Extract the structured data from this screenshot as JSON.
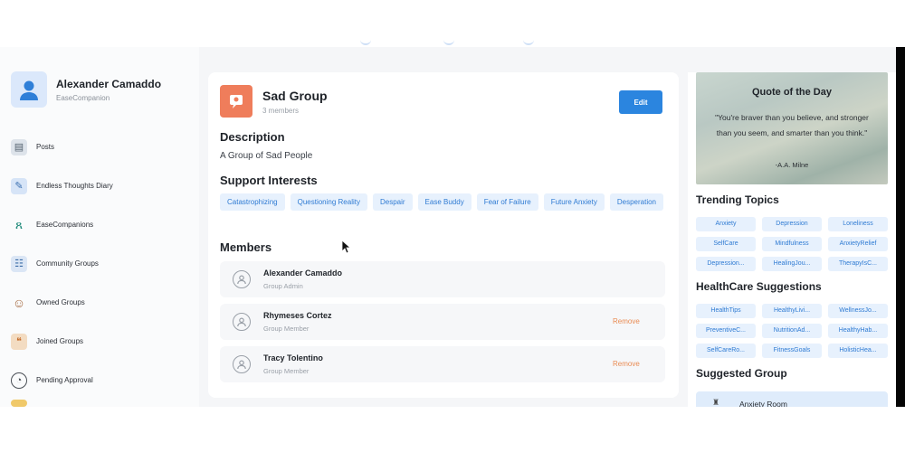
{
  "profile": {
    "name": "Alexander Camaddo",
    "subtitle": "EaseCompanion"
  },
  "sidebar": {
    "items": [
      {
        "label": "Posts",
        "icon": "posts-icon"
      },
      {
        "label": "Endless Thoughts Diary",
        "icon": "diary-icon"
      },
      {
        "label": "EaseCompanions",
        "icon": "ribbon-icon"
      },
      {
        "label": "Community Groups",
        "icon": "community-icon"
      },
      {
        "label": "Owned Groups",
        "icon": "owner-icon"
      },
      {
        "label": "Joined Groups",
        "icon": "chat-bubbles-icon"
      },
      {
        "label": "Pending Approval",
        "icon": "pending-icon"
      }
    ]
  },
  "group": {
    "title": "Sad Group",
    "members_count": "3 members",
    "edit_label": "Edit",
    "description_heading": "Description",
    "description": "A Group of Sad People",
    "interests_heading": "Support Interests",
    "interests": [
      "Catastrophizing",
      "Questioning Reality",
      "Despair",
      "Ease Buddy",
      "Fear of Failure",
      "Future Anxiety",
      "Desperation"
    ],
    "members_heading": "Members",
    "members": [
      {
        "name": "Alexander Camaddo",
        "role": "Group Admin",
        "action": ""
      },
      {
        "name": "Rhymeses Cortez",
        "role": "Group Member",
        "action": "Remove"
      },
      {
        "name": "Tracy Tolentino",
        "role": "Group Member",
        "action": "Remove"
      }
    ]
  },
  "quote": {
    "title": "Quote of the Day",
    "text": "\"You're braver than you believe, and stronger than you seem, and smarter than you think.\"",
    "author": "-A.A. Milne"
  },
  "trending": {
    "heading": "Trending Topics",
    "chips": [
      "Anxiety",
      "Depression",
      "Loneliness",
      "SelfCare",
      "Mindfulness",
      "AnxietyRelief",
      "Depression...",
      "HealingJou...",
      "TherapyIsC..."
    ]
  },
  "healthcare": {
    "heading": "HealthCare Suggestions",
    "chips": [
      "HealthTips",
      "HealthyLivi...",
      "WellnessJo...",
      "PreventiveC...",
      "NutritionAd...",
      "HealthyHab...",
      "SelfCareRo...",
      "FitnessGoals",
      "HolisticHea..."
    ]
  },
  "suggested": {
    "heading": "Suggested Group",
    "group_name": "Anxiety Room"
  },
  "colors": {
    "accent": "#2b85df",
    "chip_bg": "#e7f1fd",
    "chip_text": "#2f7bd3",
    "remove": "#e98b53",
    "group_icon": "#ef7d5b"
  }
}
